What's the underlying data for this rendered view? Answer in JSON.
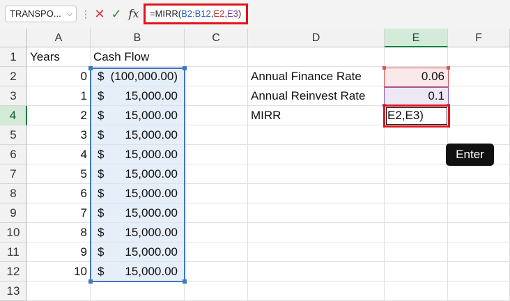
{
  "formula_bar": {
    "name_box": "TRANSPO...",
    "cancel_icon": "✕",
    "enter_icon": "✓",
    "fx_label": "fx",
    "formula_prefix": "=MIRR(",
    "ref1": "B2:B12",
    "sep1": ",",
    "ref2": "E2",
    "sep2": ",",
    "ref3": "E3",
    "formula_suffix": ")"
  },
  "grid": {
    "columns": [
      "A",
      "B",
      "C",
      "D",
      "E",
      "F"
    ],
    "rows": [
      "1",
      "2",
      "3",
      "4",
      "5",
      "6",
      "7",
      "8",
      "9",
      "10",
      "11",
      "12",
      "13"
    ],
    "a1": "Years",
    "b1": "Cash Flow",
    "years": [
      "0",
      "1",
      "2",
      "3",
      "4",
      "5",
      "6",
      "7",
      "8",
      "9",
      "10"
    ],
    "currency_symbol": "$",
    "cash_flows": [
      "(100,000.00)",
      "15,000.00",
      "15,000.00",
      "15,000.00",
      "15,000.00",
      "15,000.00",
      "15,000.00",
      "15,000.00",
      "15,000.00",
      "15,000.00",
      "15,000.00"
    ],
    "d2": "Annual Finance Rate",
    "d3": "Annual Reinvest Rate",
    "d4": "MIRR",
    "e2": "0.06",
    "e3": "0.1",
    "e4_editing": "E2,E3)"
  },
  "tooltip": {
    "text": "Enter"
  },
  "colors": {
    "highlight_red": "#e0141b",
    "range_blue": "#3f77c4",
    "range_red": "#d9554f",
    "range_purple": "#8a5bc0",
    "excel_green": "#107c41"
  }
}
